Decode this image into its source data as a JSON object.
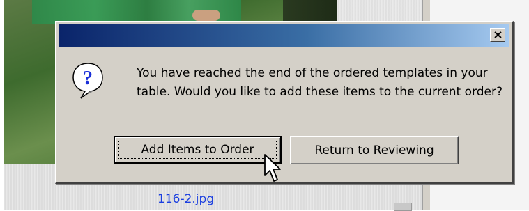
{
  "background": {
    "file_label": "116-2.jpg"
  },
  "dialog": {
    "title": "",
    "message": "You have reached the end of the ordered templates in your table. Would you like to add these items to the current order?",
    "icon": "question-icon",
    "buttons": {
      "add_label": "Add Items to Order",
      "return_label": "Return to Reviewing"
    },
    "close_icon": "close-icon"
  },
  "colors": {
    "titlebar_start": "#0a246a",
    "titlebar_end": "#a6caf0",
    "dialog_face": "#d4d0c8",
    "link_blue": "#1b3fe0"
  }
}
